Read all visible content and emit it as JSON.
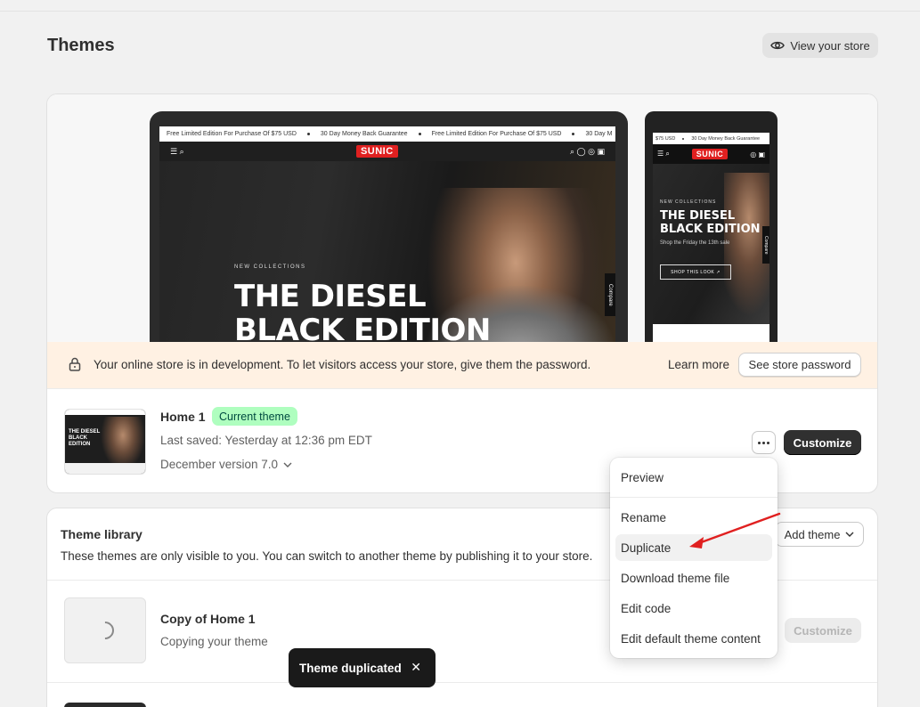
{
  "page": {
    "title": "Themes",
    "view_store_label": "View your store"
  },
  "preview": {
    "desktop": {
      "ticker": [
        "Free Limited Edition For Purchase Of $75 USD",
        "30 Day Money Back Guarantee",
        "Free Limited Edition For Purchase Of $75 USD",
        "30 Day M"
      ],
      "logo": "SUNIC",
      "eyebrow": "NEW COLLECTIONS",
      "headline_line1": "THE DIESEL",
      "headline_line2": "BLACK EDITION",
      "compare_label": "Compare"
    },
    "mobile": {
      "ticker": [
        "$75 USD",
        "30 Day Money Back Guarantee"
      ],
      "logo": "SUNIC",
      "eyebrow": "NEW COLLECTIONS",
      "headline_line1": "THE DIESEL",
      "headline_line2": "BLACK EDITION",
      "subtext": "Shop the Friday the 13th sale",
      "cta": "SHOP THIS LOOK ↗",
      "compare_label": "Compare"
    }
  },
  "banner": {
    "message": "Your online store is in development. To let visitors access your store, give them the password.",
    "learn_more": "Learn more",
    "see_password": "See store password"
  },
  "current_theme": {
    "name": "Home 1",
    "badge": "Current theme",
    "last_saved": "Last saved: Yesterday at 12:36 pm EDT",
    "version": "December version 7.0",
    "thumb_title": "THE DIESEL BLACK EDITION",
    "customize_label": "Customize"
  },
  "menu": {
    "items": [
      {
        "label": "Preview"
      },
      {
        "label": "Rename"
      },
      {
        "label": "Duplicate"
      },
      {
        "label": "Download theme file"
      },
      {
        "label": "Edit code"
      },
      {
        "label": "Edit default theme content"
      }
    ],
    "active_item": "Duplicate"
  },
  "library": {
    "title": "Theme library",
    "subtitle": "These themes are only visible to you. You can switch to another theme by publishing it to your store.",
    "add_theme_label": "Add theme",
    "items": [
      {
        "name": "Copy of Home 1",
        "status": "Copying your theme",
        "customize_label": "Customize"
      }
    ]
  },
  "toast": {
    "message": "Theme duplicated"
  },
  "colors": {
    "primary_button": "#303030",
    "badge_bg": "#affebf",
    "banner_bg": "#fff1e3",
    "arrow": "#e02020",
    "toast_bg": "#1a1a1a"
  }
}
